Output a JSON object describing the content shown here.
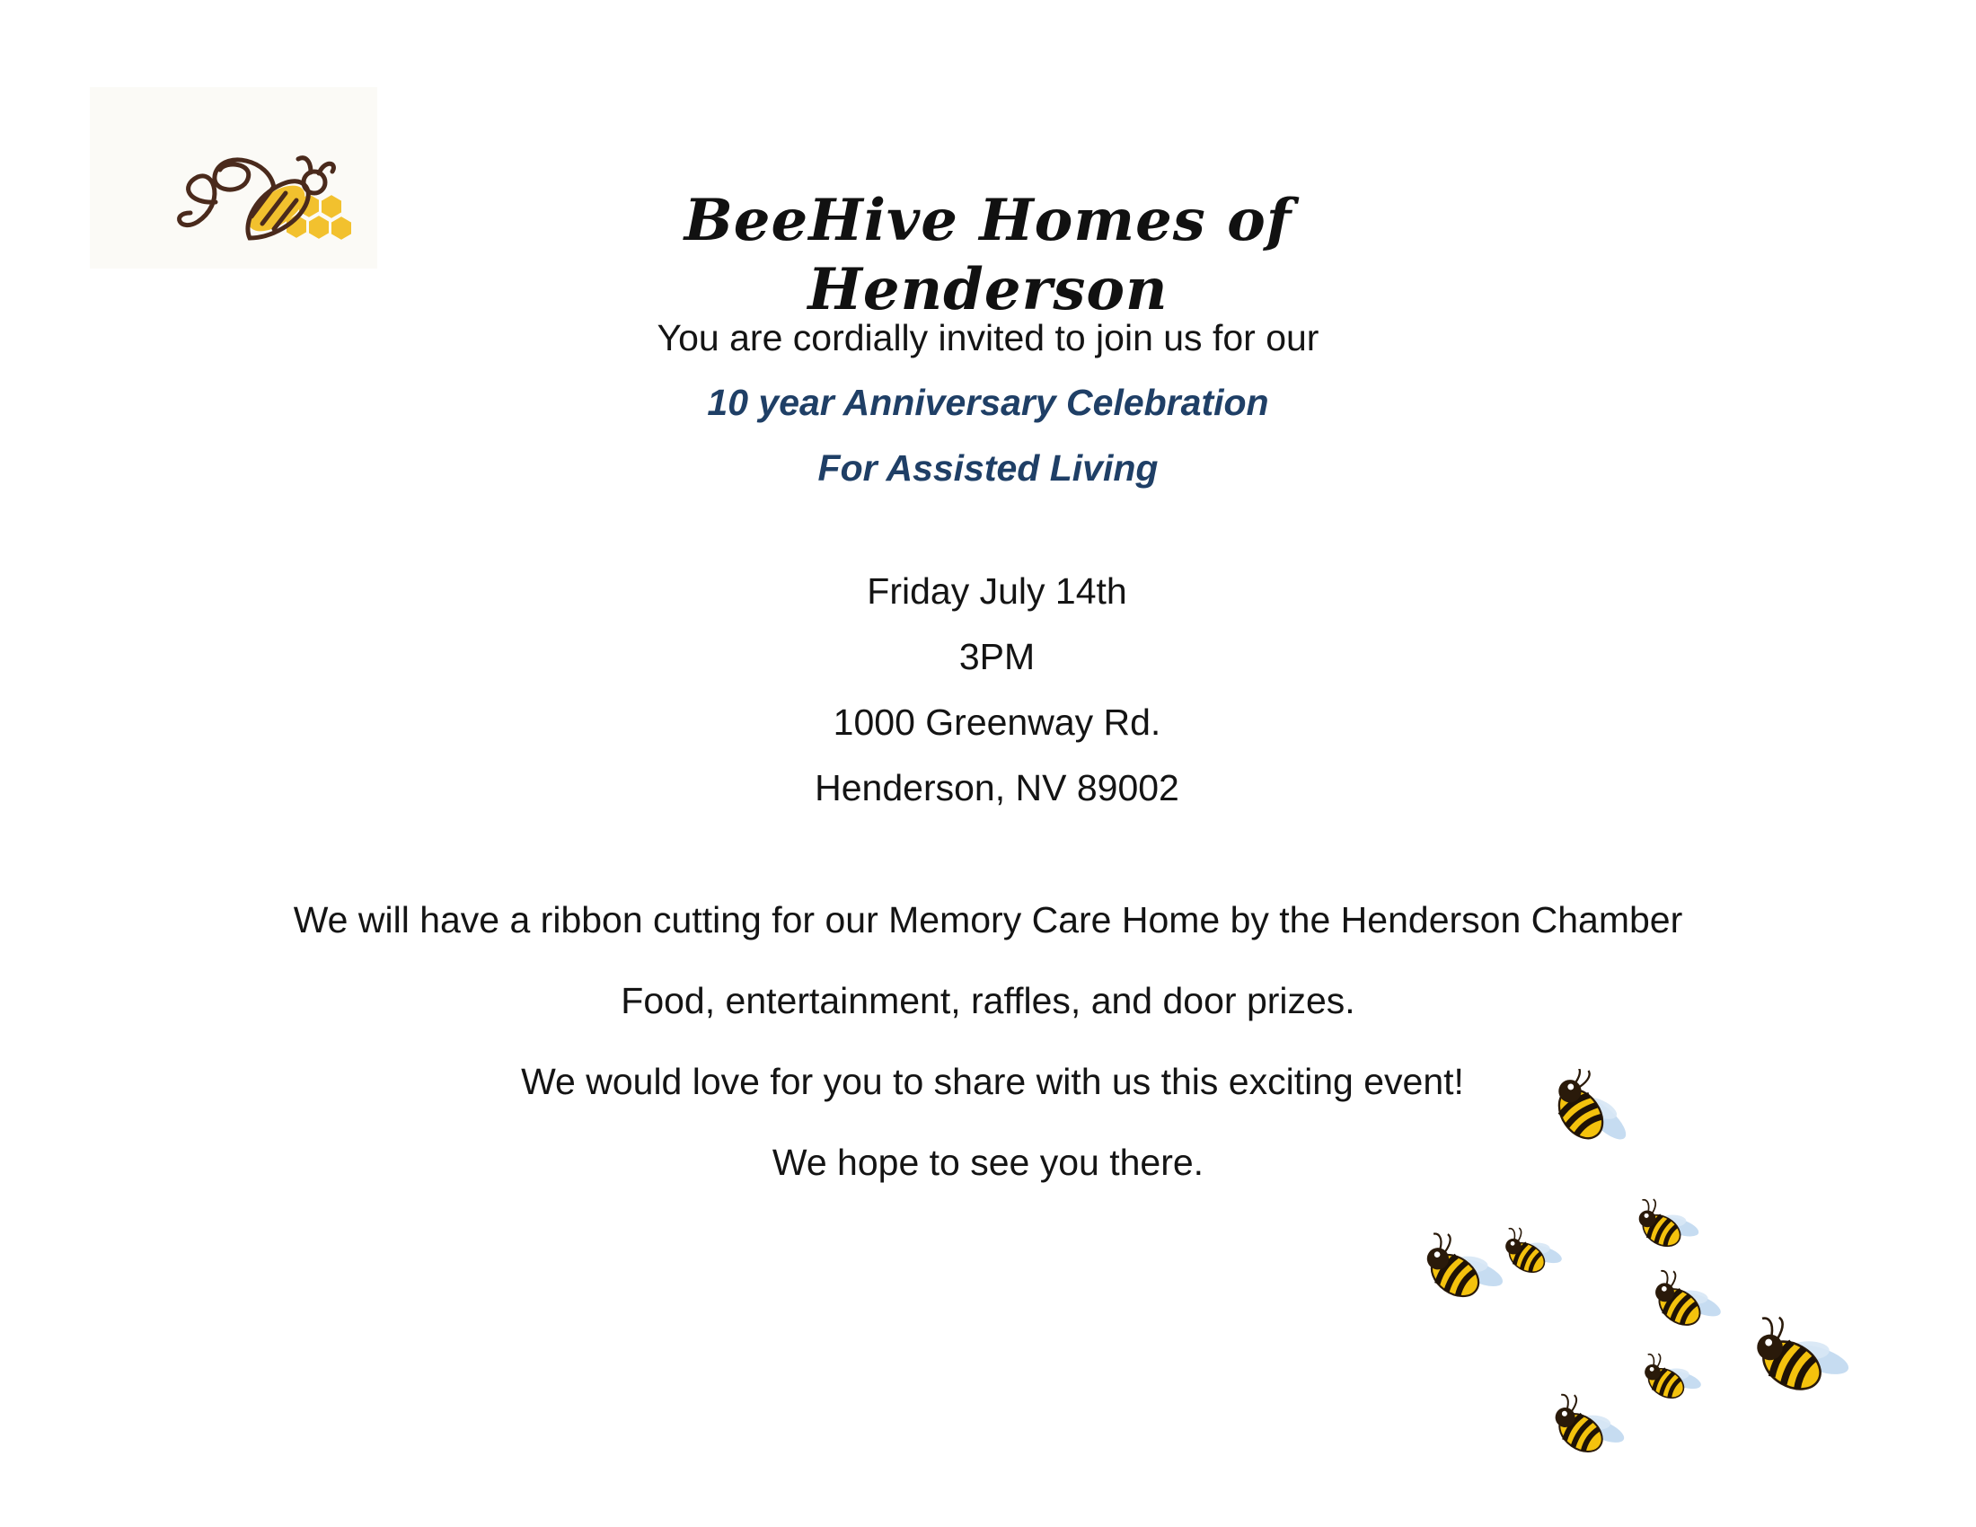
{
  "header": {
    "title": "BeeHive Homes of Henderson"
  },
  "invitation": {
    "intro": "You are cordially invited to join us for our",
    "event_line1": "10 year Anniversary Celebration",
    "event_line2": "For Assisted Living"
  },
  "details": {
    "date": "Friday July 14th",
    "time": "3PM",
    "address_line1": "1000 Greenway Rd.",
    "address_line2": "Henderson, NV 89002"
  },
  "body": {
    "ribbon": "We will have a ribbon cutting for our Memory Care Home by the Henderson Chamber",
    "activities": "Food, entertainment, raffles, and door prizes.",
    "share": "We would love for you to share with us this exciting event!",
    "closing": "We hope to see you there."
  },
  "colors": {
    "accent": "#1f3f66",
    "honey": "#f2c12e",
    "logo_brown": "#4a2a1c"
  },
  "icons": {
    "logo": "bee-logo-icon",
    "decoration": "bee-swarm-icon"
  }
}
